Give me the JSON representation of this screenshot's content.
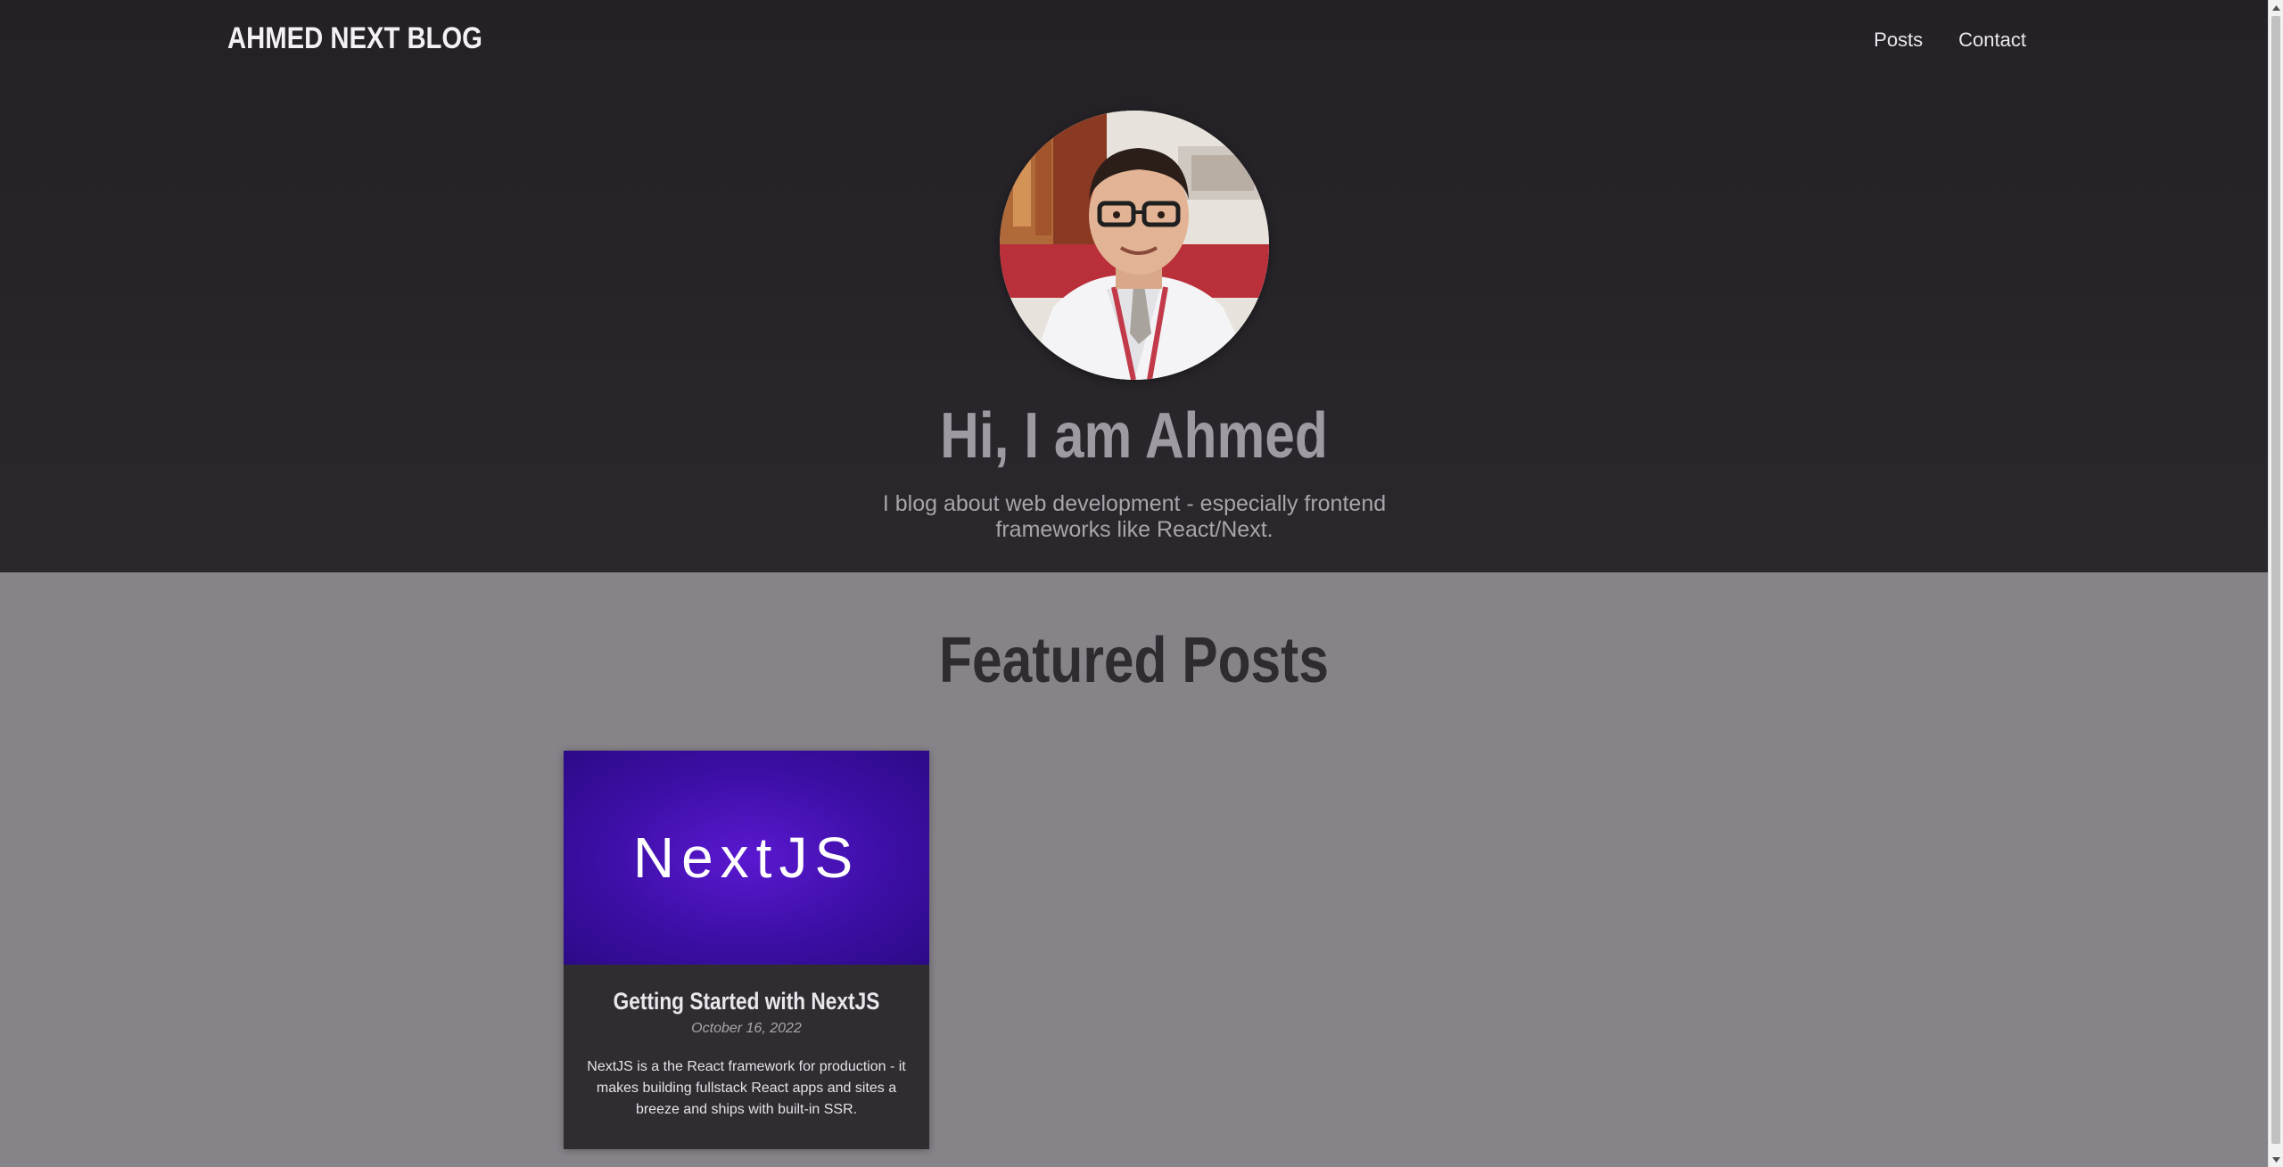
{
  "header": {
    "logo": "AHMED NEXT BLOG",
    "nav": [
      {
        "label": "Posts"
      },
      {
        "label": "Contact"
      }
    ]
  },
  "hero": {
    "title": "Hi, I am Ahmed",
    "subtitle": "I blog about web development - especially frontend frameworks like React/Next."
  },
  "featured": {
    "title": "Featured Posts",
    "posts": [
      {
        "image_text": "NextJS",
        "title": "Getting Started with NextJS",
        "date": "October 16, 2022",
        "excerpt": "NextJS is a the React framework for production - it makes building fullstack React apps and sites a breeze and ships with built-in SSR."
      }
    ]
  },
  "colors": {
    "hero_bg": "#262428",
    "page_bg": "#868389",
    "card_bg": "#302d32",
    "card_image_bg": "#4a14bb"
  }
}
